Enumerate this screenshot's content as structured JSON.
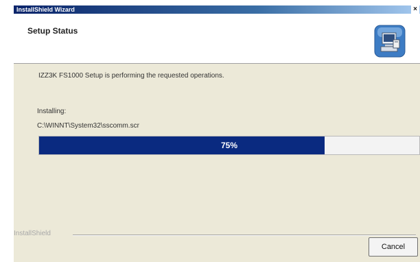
{
  "window": {
    "title": "InstallShield Wizard",
    "close_glyph": "×"
  },
  "header": {
    "title": "Setup Status",
    "icon": "installer-computer-icon"
  },
  "main": {
    "description": "IZZ3K FS1000 Setup is performing the requested operations.",
    "status_label": "Installing:",
    "status_path": "C:\\WINNT\\System32\\sscomm.scr",
    "progress_percent": 75,
    "progress_text": "75%"
  },
  "footer": {
    "brand": "InstallShield",
    "cancel_label": "Cancel"
  },
  "colors": {
    "progress_fill": "#0a2a80",
    "title_bar": "#0a246a",
    "dialog_bg": "#ece9d8"
  }
}
